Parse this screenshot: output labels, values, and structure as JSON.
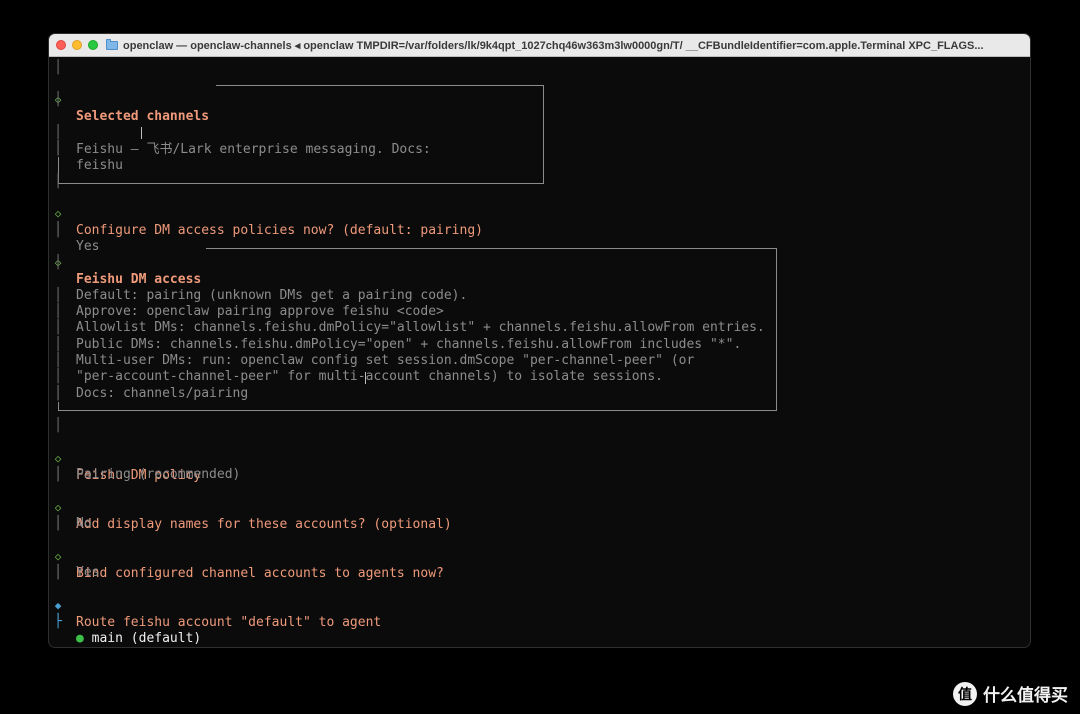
{
  "window": {
    "title": "openclaw — openclaw-channels ◂ openclaw TMPDIR=/var/folders/lk/9k4qpt_1027chq46w363m3lw0000gn/T/ __CFBundleIdentifier=com.apple.Terminal XPC_FLAGS..."
  },
  "sections": {
    "selected_channels": {
      "heading": "Selected channels",
      "body_line1": "Feishu — 飞书/Lark enterprise messaging. Docs:",
      "body_line2": "feishu"
    },
    "dm_policy_prompt": {
      "question": "Configure DM access policies now? (default: pairing)",
      "answer": "Yes"
    },
    "feishu_dm_access": {
      "heading": "Feishu DM access",
      "lines": [
        "Default: pairing (unknown DMs get a pairing code).",
        "Approve: openclaw pairing approve feishu <code>",
        "Allowlist DMs: channels.feishu.dmPolicy=\"allowlist\" + channels.feishu.allowFrom entries.",
        "Public DMs: channels.feishu.dmPolicy=\"open\" + channels.feishu.allowFrom includes \"*\".",
        "Multi-user DMs: run: openclaw config set session.dmScope \"per-channel-peer\" (or",
        "\"per-account-channel-peer\" for multi-account channels) to isolate sessions.",
        "Docs: channels/pairing"
      ]
    },
    "feishu_dm_policy": {
      "question": "Feishu DM policy",
      "answer": "Pairing (recommended)"
    },
    "display_names": {
      "question": "Add display names for these accounts? (optional)",
      "answer": "No"
    },
    "bind_accounts": {
      "question": "Bind configured channel accounts to agents now?",
      "answer": "Yes"
    },
    "route": {
      "question": "Route feishu account \"default\" to agent",
      "selected_option": "main (default)",
      "bullet": "●"
    }
  },
  "watermark": {
    "logo": "值",
    "text": "什么值得买"
  },
  "colors": {
    "accent": "#ef9a7a",
    "diamond": "#6ab04c",
    "active_diamond": "#4a9fd5",
    "selected_dot": "#3cc04a"
  }
}
